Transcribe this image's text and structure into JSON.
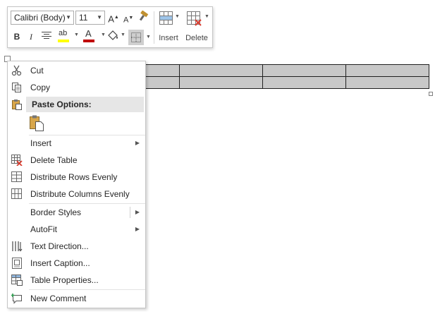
{
  "toolbar": {
    "font_name": "Calibri (Body)",
    "font_size": "11",
    "grow_font_label": "A",
    "shrink_font_label": "A",
    "bold_label": "B",
    "italic_label": "I",
    "highlight_label": "ab",
    "font_color_label": "A",
    "insert_label": "Insert",
    "delete_label": "Delete",
    "colors": {
      "highlight": "#ffff00",
      "font_color": "#c00000"
    }
  },
  "table": {
    "rows": [
      [
        "",
        "",
        "",
        "",
        ""
      ],
      [
        "",
        "",
        "",
        "",
        ""
      ]
    ]
  },
  "menu": {
    "items": [
      {
        "label": "Cut",
        "icon": "scissors-icon"
      },
      {
        "label": "Copy",
        "icon": "copy-icon"
      },
      {
        "label": "Paste Options:",
        "icon": "paste-icon"
      },
      {
        "label": "Insert",
        "icon": ""
      },
      {
        "label": "Delete Table",
        "icon": "delete-table-icon"
      },
      {
        "label": "Distribute Rows Evenly",
        "icon": "distribute-rows-icon"
      },
      {
        "label": "Distribute Columns Evenly",
        "icon": "distribute-columns-icon"
      },
      {
        "label": "Border Styles",
        "icon": ""
      },
      {
        "label": "AutoFit",
        "icon": ""
      },
      {
        "label": "Text Direction...",
        "icon": "text-direction-icon"
      },
      {
        "label": "Insert Caption...",
        "icon": "insert-caption-icon"
      },
      {
        "label": "Table Properties...",
        "icon": "table-properties-icon"
      },
      {
        "label": "New Comment",
        "icon": "new-comment-icon"
      }
    ]
  }
}
